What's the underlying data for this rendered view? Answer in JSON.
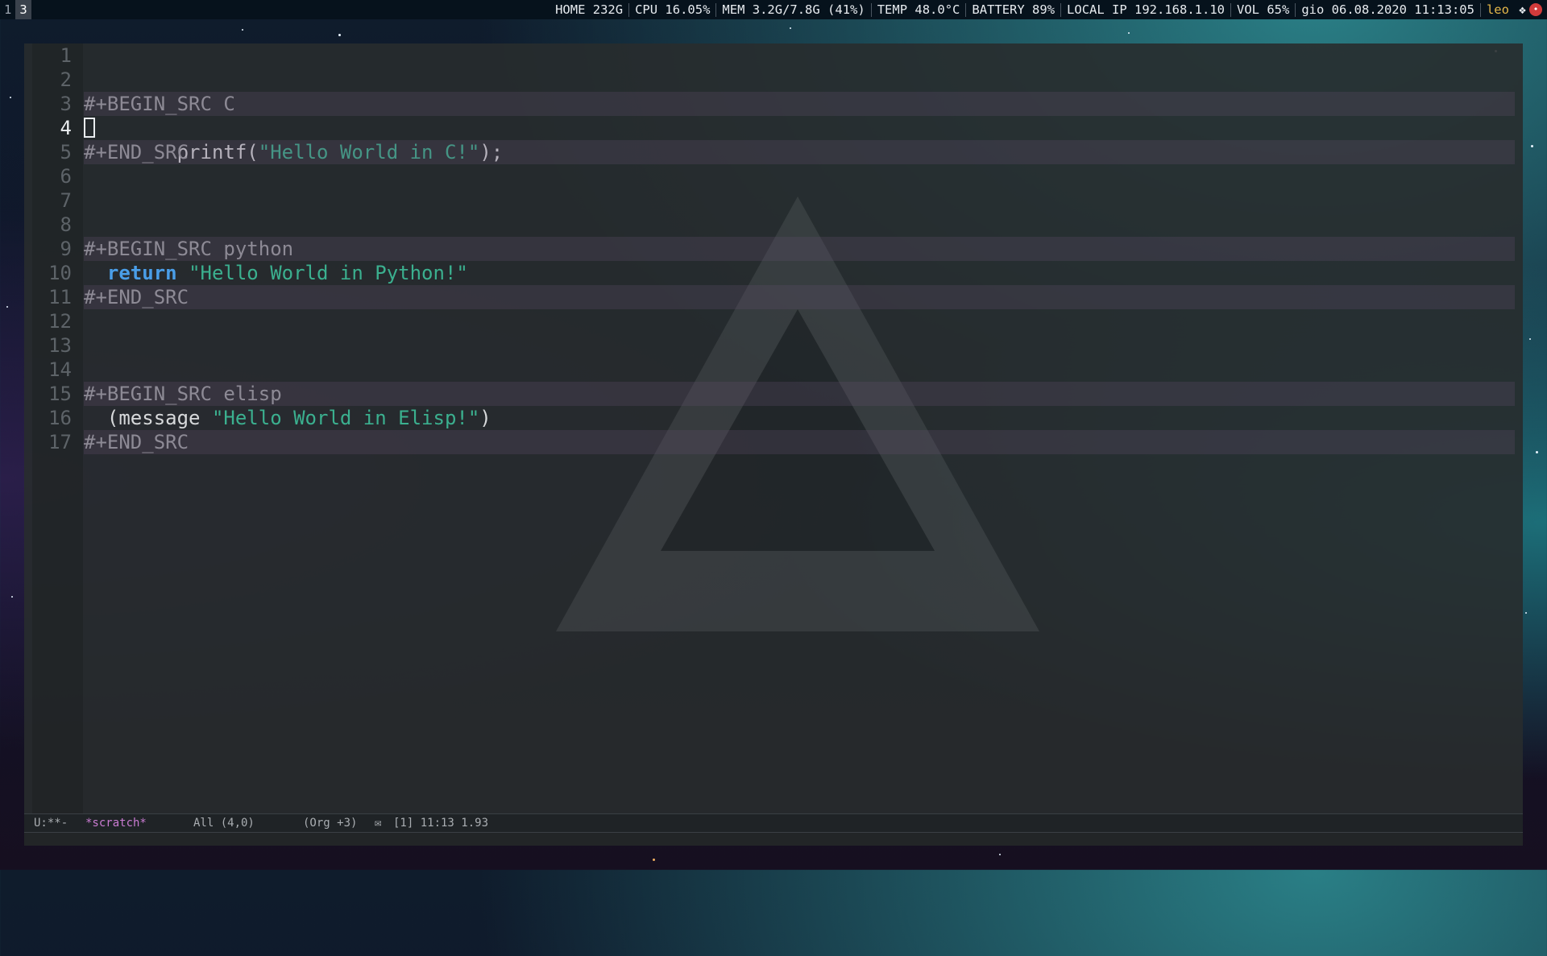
{
  "topbar": {
    "workspaces": [
      {
        "label": "1",
        "active": false
      },
      {
        "label": "3",
        "active": true
      }
    ],
    "status": {
      "home": "HOME 232G",
      "cpu": "CPU 16.05%",
      "mem": "MEM 3.2G/7.8G (41%)",
      "temp": "TEMP 48.0°C",
      "battery": "BATTERY 89%",
      "ip": "LOCAL IP 192.168.1.10",
      "vol": "VOL 65%",
      "datetime": "gio 06.08.2020 11:13:05"
    },
    "user": "leo",
    "tray": {
      "dropbox_icon": "dropbox-icon",
      "alert_icon": "red-circle-icon"
    }
  },
  "editor": {
    "line_numbers": [
      "1",
      "2",
      "3",
      "4",
      "5",
      "6",
      "7",
      "8",
      "9",
      "10",
      "11",
      "12",
      "13",
      "14",
      "15",
      "16",
      "17"
    ],
    "current_line": 4,
    "lines": {
      "l3": "#+BEGIN_SRC C",
      "l4_pre": "printf(",
      "l4_str": "\"Hello World in C!\"",
      "l4_post": ");",
      "l5": "#+END_SRC",
      "l9": "#+BEGIN_SRC python",
      "l10_kw": "return",
      "l10_str": "\"Hello World in Python!\"",
      "l11": "#+END_SRC",
      "l15": "#+BEGIN_SRC elisp",
      "l16_pre": "(message ",
      "l16_str": "\"Hello World in Elisp!\"",
      "l16_post": ")",
      "l17": "#+END_SRC"
    }
  },
  "modeline": {
    "state": "U:**-",
    "buffer": "*scratch*",
    "position": "All (4,0)",
    "mode": "(Org +3)",
    "mail_icon": "mail-icon",
    "extra": "[1] 11:13 1.93"
  },
  "colors": {
    "keyword": "#4a9ee8",
    "string": "#3bb08f",
    "block_line": "#8d8a95",
    "buffer_name": "#c97bd1",
    "user": "#e6b84a"
  }
}
